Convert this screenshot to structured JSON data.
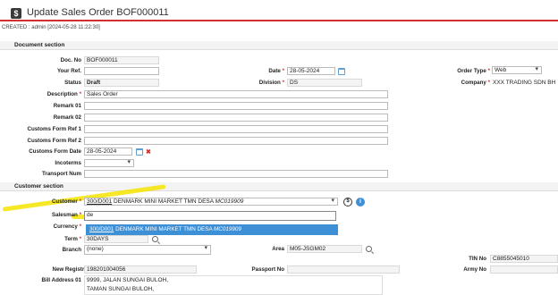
{
  "title": {
    "icon_text": "$",
    "text": "Update Sales Order BOF000011"
  },
  "created": "CREATED : admin [2024-05-28 11:22:30]",
  "document_section": {
    "heading": "Document section",
    "doc_no": {
      "label": "Doc. No",
      "value": "BOF000011"
    },
    "your_ref": {
      "label": "Your Ref.",
      "value": ""
    },
    "status": {
      "label": "Status",
      "value": "Draft"
    },
    "description": {
      "label": "Description",
      "value": "Sales Order"
    },
    "remark01": {
      "label": "Remark 01",
      "value": ""
    },
    "remark02": {
      "label": "Remark 02",
      "value": ""
    },
    "customs_form_ref1": {
      "label": "Customs Form Ref 1",
      "value": ""
    },
    "customs_form_ref2": {
      "label": "Customs Form Ref 2",
      "value": ""
    },
    "customs_form_date": {
      "label": "Customs Form Date",
      "value": "28-05-2024"
    },
    "incoterms": {
      "label": "Incoterms",
      "value": ""
    },
    "transport_num": {
      "label": "Transport Num",
      "value": ""
    },
    "date": {
      "label": "Date",
      "value": "28-05-2024"
    },
    "division": {
      "label": "Division",
      "value": "DS"
    },
    "order_type": {
      "label": "Order Type",
      "value": "Web"
    },
    "company": {
      "label": "Company",
      "value": "XXX TRADING SDN BH"
    }
  },
  "customer_section": {
    "heading": "Customer section",
    "customer": {
      "label": "Customer",
      "code": "300/D001",
      "name": "DENMARK MINI MARKET TMN DESA",
      "extra": "MC019909"
    },
    "salesman": {
      "label": "Salesman",
      "value": "de"
    },
    "currency": {
      "label": "Currency",
      "value": ""
    },
    "term": {
      "label": "Term",
      "value": "30DAYS"
    },
    "branch": {
      "label": "Branch",
      "value": "(none)"
    },
    "area": {
      "label": "Area",
      "value": "M05-JSGM02"
    },
    "tin_no": {
      "label": "TIN No",
      "value": "C8855045010"
    },
    "new_reg_no": {
      "label": "New Registration No",
      "value": "198201004056"
    },
    "passport_no": {
      "label": "Passport No",
      "value": ""
    },
    "army_no": {
      "label": "Army No",
      "value": ""
    },
    "bill_address01": {
      "label": "Bill Address 01",
      "line1": "9999, JALAN SUNGAI BULOH,",
      "line2": "TAMAN SUNGAI BULOH,"
    }
  },
  "dropdown_option": {
    "code": "300/D001",
    "name": "DENMARK MINI MARKET TMN DESA",
    "extra": "MC019909"
  },
  "icons": {
    "required_mark": "*",
    "clear": "✖",
    "info": "i",
    "lookup": "$"
  },
  "colors": {
    "accent_red": "#d32f2f",
    "highlight_yellow": "#f5e400",
    "selection_blue": "#3d8fd6"
  }
}
